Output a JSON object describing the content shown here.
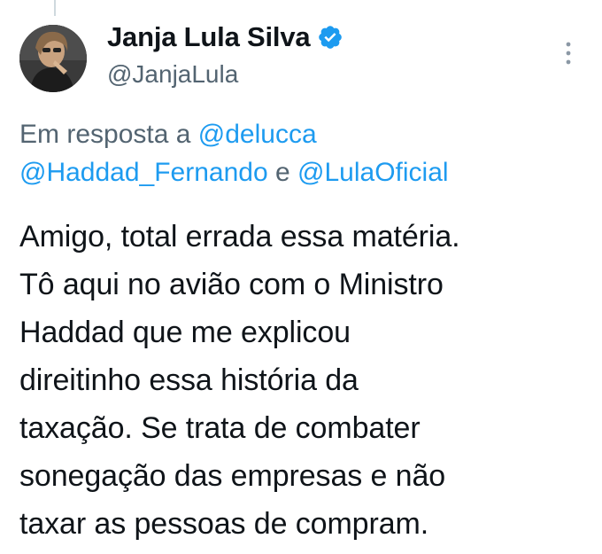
{
  "author": {
    "display_name": "Janja Lula Silva",
    "handle": "@JanjaLula",
    "verified": true,
    "avatar_icon": "profile-photo"
  },
  "reply_context": {
    "prefix": "Em resposta a",
    "mention_1": "@delucca",
    "mention_2": "@Haddad_Fernando",
    "conjunction": "e",
    "mention_3": "@LulaOficial"
  },
  "tweet": {
    "text": "Amigo, total errada essa matéria.\nTô aqui no avião com o Ministro\nHaddad que me explicou\ndireitinho essa história da\ntaxação. Se trata de combater\nsonegação das empresas e não\ntaxar as pessoas de compram."
  },
  "colors": {
    "accent": "#1d9bf0",
    "secondary_text": "#536471",
    "primary_text": "#0f1419"
  },
  "icons": {
    "verified": "verified-badge-icon",
    "more": "more-options-icon"
  }
}
